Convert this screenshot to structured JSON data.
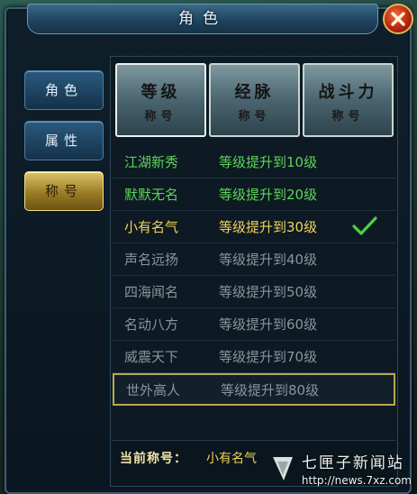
{
  "window": {
    "title": "角色"
  },
  "side_tabs": [
    {
      "label": "角色",
      "active": false
    },
    {
      "label": "属性",
      "active": false
    },
    {
      "label": "称号",
      "active": true
    }
  ],
  "categories": [
    {
      "top": "等级",
      "sub": "称号"
    },
    {
      "top": "经脉",
      "sub": "称号"
    },
    {
      "top": "战斗力",
      "sub": "称号"
    }
  ],
  "titles": [
    {
      "name": "江湖新秀",
      "requirement": "等级提升到10级",
      "state": "unlocked"
    },
    {
      "name": "默默无名",
      "requirement": "等级提升到20级",
      "state": "unlocked"
    },
    {
      "name": "小有名气",
      "requirement": "等级提升到30级",
      "state": "current"
    },
    {
      "name": "声名远扬",
      "requirement": "等级提升到40级",
      "state": "locked"
    },
    {
      "name": "四海闻名",
      "requirement": "等级提升到50级",
      "state": "locked"
    },
    {
      "name": "名动八方",
      "requirement": "等级提升到60级",
      "state": "locked"
    },
    {
      "name": "威震天下",
      "requirement": "等级提升到70级",
      "state": "locked"
    },
    {
      "name": "世外高人",
      "requirement": "等级提升到80级",
      "state": "locked"
    }
  ],
  "footer": {
    "label": "当前称号：",
    "value": "小有名气"
  },
  "watermark": {
    "title": "七匣子新闻站",
    "url": "http://news.7xz.com"
  },
  "colors": {
    "unlocked": "#5fd35a",
    "current": "#f0d25c",
    "locked": "#8a949b",
    "gold": "#d9c46a"
  }
}
